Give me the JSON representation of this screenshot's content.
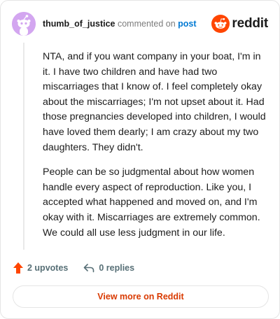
{
  "header": {
    "username": "thumb_of_justice",
    "commented_text": "commented on",
    "post_link": "post",
    "logo_text": "reddit"
  },
  "comment": {
    "paragraphs": [
      "NTA, and if you want company in your boat, I'm in it. I have two children and have had two miscarriages that I know of. I feel completely okay about the miscarriages; I'm not upset about it. Had those pregnancies developed into children, I would have loved them dearly; I am crazy about my two daughters. They didn't.",
      "People can be so judgmental about how women handle every aspect of reproduction. Like you, I accepted what happened and moved on, and I'm okay with it. Miscarriages are extremely common. We could all use less judgment in our life."
    ]
  },
  "actions": {
    "upvotes": "2 upvotes",
    "replies": "0 replies"
  },
  "footer": {
    "view_button": "View more on Reddit"
  },
  "colors": {
    "avatar": "#d3a6f0",
    "brand": "#ff4500",
    "link": "#0079d3",
    "button_text": "#d93a00"
  },
  "icons": {
    "avatar": "snoo-avatar-icon",
    "logo": "reddit-logo-icon",
    "upvote": "upvote-arrow-icon",
    "reply": "reply-arrow-icon"
  }
}
